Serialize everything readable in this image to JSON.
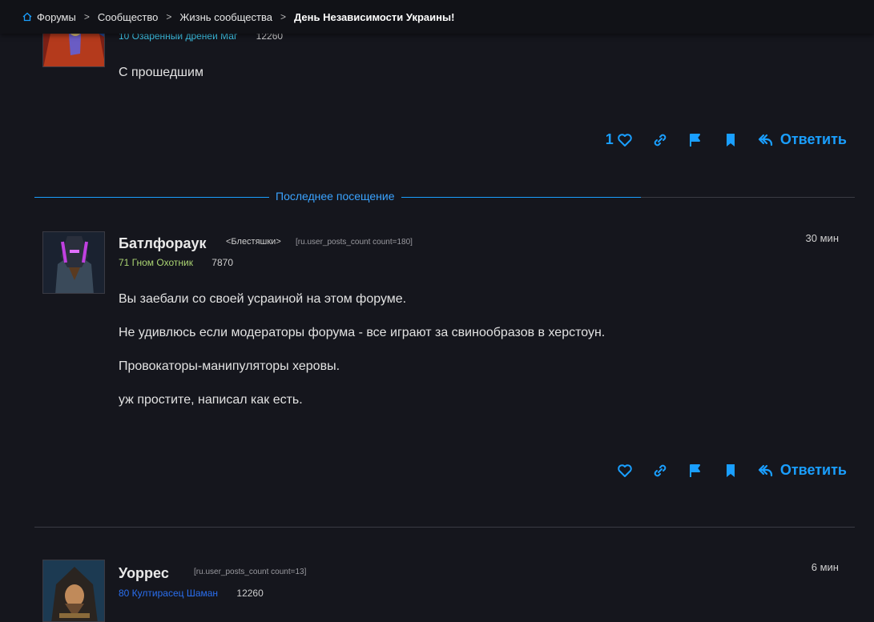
{
  "breadcrumb": {
    "items": [
      "Форумы",
      "Сообщество",
      "Жизнь сообщества"
    ],
    "current": "День Независимости Украины!"
  },
  "post1": {
    "char_class": "10 Озаренный дренеи Маг",
    "class_color": "#3fc7eb",
    "achievements": "12260",
    "body": [
      "С прошедшим"
    ],
    "like_count": "1",
    "reply_label": "Ответить"
  },
  "last_visit": {
    "label": "Последнее посещение"
  },
  "post2": {
    "author": "Батлфораук",
    "title": "<Блестяшки>",
    "postcount_tag": "[ru.user_posts_count count=180]",
    "char_class": "71 Гном Охотник",
    "class_color": "#aad372",
    "achievements": "7870",
    "time": "30 мин",
    "body": [
      "Вы заебали со своей усраиной на этом форуме.",
      "Не удивлюсь если модераторы форума - все играют за свинообразов в херстоун.",
      "Провокаторы-манипуляторы херовы.",
      "уж простите, написал как есть."
    ],
    "reply_label": "Ответить"
  },
  "post3": {
    "author": "Уоррес",
    "postcount_tag": "[ru.user_posts_count count=13]",
    "char_class": "80 Култирасец Шаман",
    "class_color": "#2a6ff0",
    "achievements": "12260",
    "time": "6 мин"
  },
  "colors": {
    "accent": "#1a9fff",
    "background": "#15161d",
    "header": "#111217"
  },
  "icons": [
    "home-icon",
    "heart-icon",
    "link-icon",
    "flag-icon",
    "bookmark-icon",
    "reply-icon"
  ]
}
